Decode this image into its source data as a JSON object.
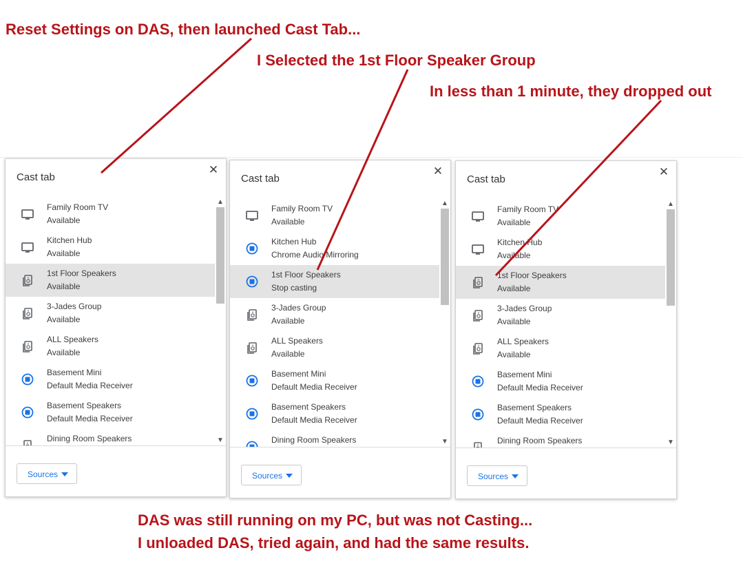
{
  "annotations": {
    "top_left": "Reset Settings on DAS, then launched Cast Tab...",
    "top_middle": "I Selected the 1st Floor Speaker Group",
    "top_right": "In less than 1 minute, they dropped out",
    "bottom_line1": "DAS was still running on my PC, but was not Casting...",
    "bottom_line2": "I unloaded DAS, tried again, and had the same results.",
    "color": "#b8141a"
  },
  "dialogs": [
    {
      "title": "Cast tab",
      "close_icon": "close-icon",
      "sources_label": "Sources",
      "sinks": [
        {
          "name": "Family Room TV",
          "status": "Available",
          "icon": "tv-icon",
          "selected": false
        },
        {
          "name": "Kitchen Hub",
          "status": "Available",
          "icon": "tv-icon",
          "selected": false
        },
        {
          "name": "1st Floor Speakers",
          "status": "Available",
          "icon": "speaker-group-icon",
          "selected": true
        },
        {
          "name": "3-Jades Group",
          "status": "Available",
          "icon": "speaker-group-icon",
          "selected": false
        },
        {
          "name": "ALL Speakers",
          "status": "Available",
          "icon": "speaker-group-icon",
          "selected": false
        },
        {
          "name": "Basement Mini",
          "status": "Default Media Receiver",
          "icon": "cast-active-icon",
          "selected": false
        },
        {
          "name": "Basement Speakers",
          "status": "Default Media Receiver",
          "icon": "cast-active-icon",
          "selected": false
        },
        {
          "name": "Dining Room Speakers",
          "status": "",
          "icon": "speaker-icon",
          "selected": false
        }
      ]
    },
    {
      "title": "Cast tab",
      "close_icon": "close-icon",
      "sources_label": "Sources",
      "sinks": [
        {
          "name": "Family Room TV",
          "status": "Available",
          "icon": "tv-icon",
          "selected": false
        },
        {
          "name": "Kitchen Hub",
          "status": "Chrome Audio Mirroring",
          "icon": "cast-active-icon",
          "selected": false
        },
        {
          "name": "1st Floor Speakers",
          "status": "Stop casting",
          "icon": "cast-active-icon",
          "selected": true
        },
        {
          "name": "3-Jades Group",
          "status": "Available",
          "icon": "speaker-group-icon",
          "selected": false
        },
        {
          "name": "ALL Speakers",
          "status": "Available",
          "icon": "speaker-group-icon",
          "selected": false
        },
        {
          "name": "Basement Mini",
          "status": "Default Media Receiver",
          "icon": "cast-active-icon",
          "selected": false
        },
        {
          "name": "Basement Speakers",
          "status": "Default Media Receiver",
          "icon": "cast-active-icon",
          "selected": false
        },
        {
          "name": "Dining Room Speakers",
          "status": "",
          "icon": "cast-active-icon",
          "selected": false
        }
      ]
    },
    {
      "title": "Cast tab",
      "close_icon": "close-icon",
      "sources_label": "Sources",
      "sinks": [
        {
          "name": "Family Room TV",
          "status": "Available",
          "icon": "tv-icon",
          "selected": false
        },
        {
          "name": "Kitchen Hub",
          "status": "Available",
          "icon": "tv-icon",
          "selected": false
        },
        {
          "name": "1st Floor Speakers",
          "status": "Available",
          "icon": "speaker-group-icon",
          "selected": true
        },
        {
          "name": "3-Jades Group",
          "status": "Available",
          "icon": "speaker-group-icon",
          "selected": false
        },
        {
          "name": "ALL Speakers",
          "status": "Available",
          "icon": "speaker-group-icon",
          "selected": false
        },
        {
          "name": "Basement Mini",
          "status": "Default Media Receiver",
          "icon": "cast-active-icon",
          "selected": false
        },
        {
          "name": "Basement Speakers",
          "status": "Default Media Receiver",
          "icon": "cast-active-icon",
          "selected": false
        },
        {
          "name": "Dining Room Speakers",
          "status": "",
          "icon": "speaker-icon",
          "selected": false
        }
      ]
    }
  ]
}
